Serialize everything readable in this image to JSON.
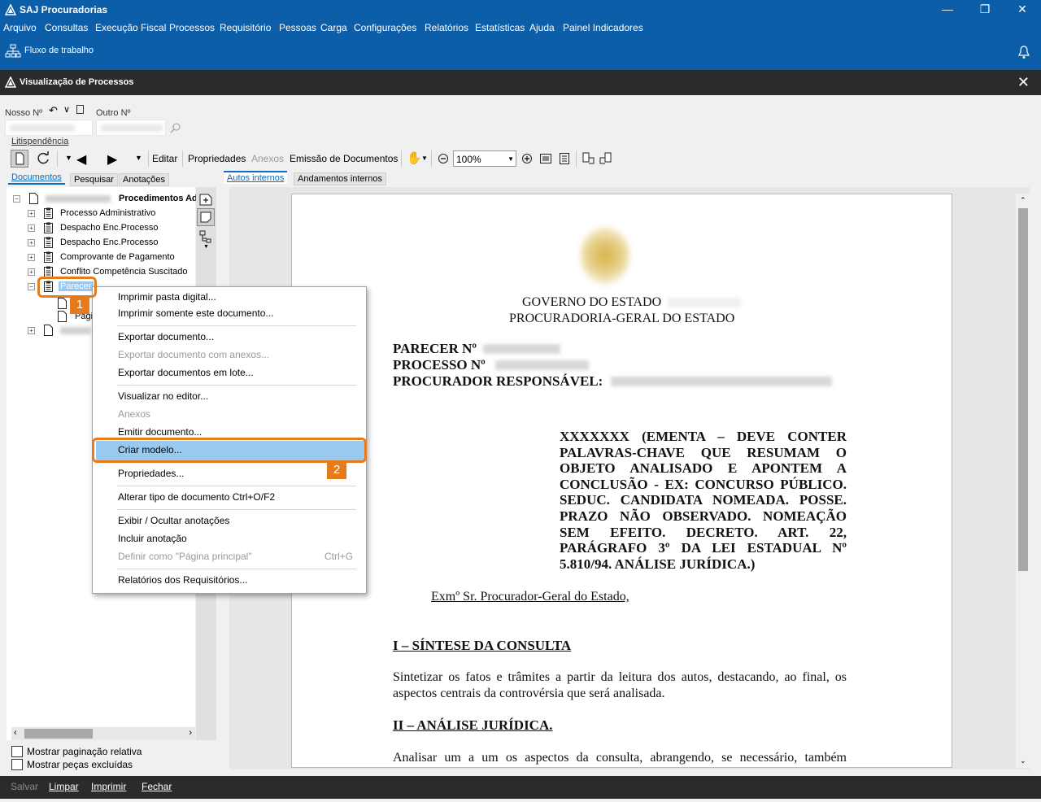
{
  "window": {
    "title": "SAJ Procuradorias"
  },
  "menu": [
    "Arquivo",
    "Consultas",
    "Execução Fiscal",
    "Processos",
    "Requisitório",
    "Pessoas",
    "Carga",
    "Configurações",
    "Relatórios",
    "Estatísticas",
    "Ajuda",
    "Painel Indicadores"
  ],
  "workflow": {
    "label": "Fluxo de trabalho"
  },
  "inner_window": {
    "title": "Visualização de Processos"
  },
  "search": {
    "nosso_label": "Nosso Nº",
    "outro_label": "Outro Nº",
    "litispendencia": "Litispendência"
  },
  "toolbar": {
    "editar": "Editar",
    "propriedades": "Propriedades",
    "anexos": "Anexos",
    "emissao": "Emissão de Documentos",
    "zoom": "100%"
  },
  "left_tabs": [
    "Documentos",
    "Pesquisar",
    "Anotações"
  ],
  "right_tabs": [
    "Autos internos",
    "Andamentos internos"
  ],
  "tree": {
    "root_label": "Procedimentos Ad",
    "items": [
      "Processo Administrativo",
      "Despacho Enc.Processo",
      "Despacho Enc.Processo",
      "Comprovante de Pagamento",
      "Conflito Competência Suscitado",
      "Parecer"
    ],
    "sub_item": "Pági"
  },
  "context_menu": {
    "items": [
      "Imprimir pasta digital...",
      "Imprimir somente este documento...",
      "Exportar documento...",
      "Exportar documento com anexos...",
      "Exportar documentos em lote...",
      "Visualizar no editor...",
      "Anexos",
      "Emitir documento...",
      "Criar modelo...",
      "Propriedades...",
      "Alterar tipo de documento  Ctrl+O/F2",
      "Exibir / Ocultar anotações",
      "Incluir anotação",
      "Definir como \"Página principal\"",
      "Relatórios dos Requisitórios..."
    ],
    "shortcut": "Ctrl+G"
  },
  "callouts": [
    "1",
    "2"
  ],
  "document": {
    "header1": "GOVERNO DO ESTADO",
    "header2": "PROCURADORIA-GERAL DO ESTADO",
    "parecer": "PARECER Nº",
    "processo": "PROCESSO Nº",
    "procurador": "PROCURADOR RESPONSÁVEL:",
    "ementa": [
      "XXXXXXX (EMENTA – DEVE CONTER",
      "PALAVRAS-CHAVE QUE RESUMAM O",
      "OBJETO ANALISADO E APONTEM A",
      "CONCLUSÃO - EX: CONCURSO PÚBLICO.",
      "SEDUC. CANDIDATA NOMEADA. POSSE.",
      "PRAZO NÃO OBSERVADO. NOMEAÇÃO",
      "SEM EFEITO. DECRETO. ART. 22,",
      "PARÁGRAFO 3º DA LEI ESTADUAL Nº",
      "5.810/94. ANÁLISE JURÍDICA.)"
    ],
    "salutation": "Exmº Sr. Procurador-Geral do Estado,",
    "section1": "I – SÍNTESE DA CONSULTA",
    "para1": [
      "Sintetizar os fatos e trâmites a partir da leitura dos autos, destacando, ao final, os",
      "aspectos centrais da controvérsia que será analisada."
    ],
    "section2": "II – ANÁLISE JURÍDICA.",
    "para2": [
      "Analisar um a um os aspectos da consulta, abrangendo, se necessário, também"
    ]
  },
  "options": [
    "Mostrar paginação relativa",
    "Mostrar peças excluídas"
  ],
  "bottom": [
    "Salvar",
    "Limpar",
    "Imprimir",
    "Fechar"
  ]
}
